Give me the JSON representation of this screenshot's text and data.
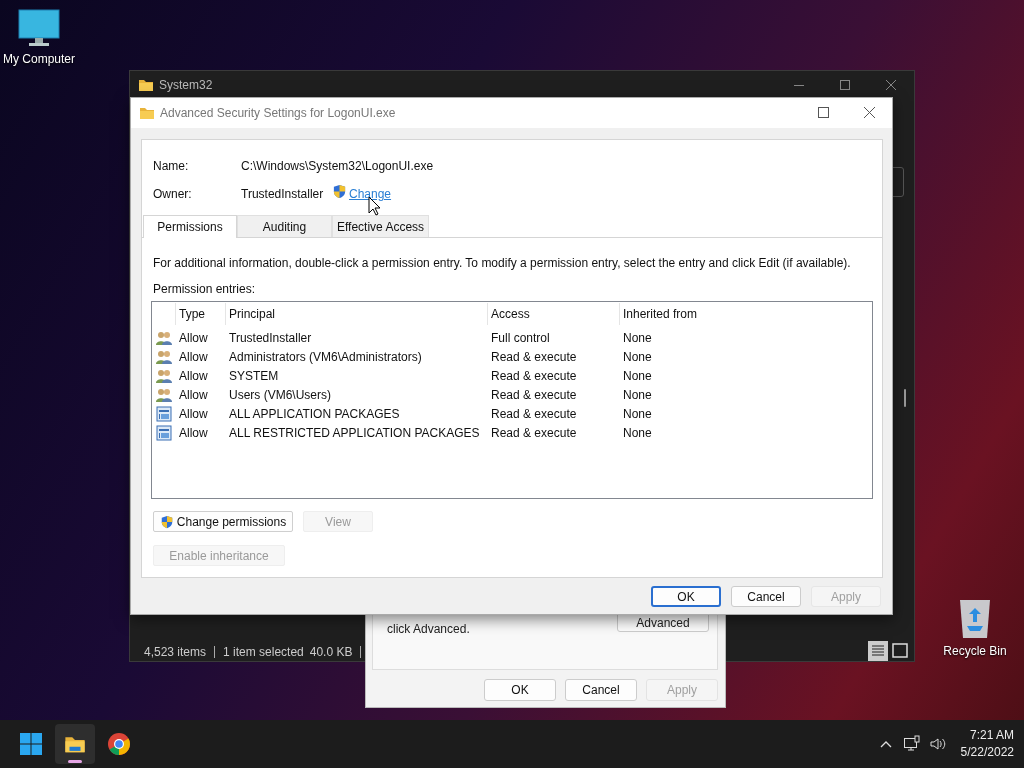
{
  "desktop_icons": [
    {
      "kind": "computer",
      "label": "My Computer"
    },
    {
      "kind": "recycle",
      "label": "Recycle Bin"
    }
  ],
  "explorer": {
    "title": "System32",
    "status_bar": [
      "4,523 items",
      "1 item selected",
      "40.0 KB"
    ]
  },
  "properties_dialog": {
    "text": "click Advanced.",
    "advanced_button": "Advanced",
    "buttons": [
      {
        "label": "OK",
        "disabled": false
      },
      {
        "label": "Cancel",
        "disabled": false
      },
      {
        "label": "Apply",
        "disabled": true
      }
    ]
  },
  "security_dialog": {
    "title": "Advanced Security Settings for LogonUI.exe",
    "name_label": "Name:",
    "name_value": "C:\\Windows\\System32\\LogonUI.exe",
    "owner_label": "Owner:",
    "owner_value": "TrustedInstaller",
    "change_link": "Change",
    "tabs": [
      {
        "label": "Permissions",
        "selected": true
      },
      {
        "label": "Auditing",
        "selected": false
      },
      {
        "label": "Effective Access",
        "selected": false
      }
    ],
    "info_text": "For additional information, double-click a permission entry. To modify a permission entry, select the entry and click Edit (if available).",
    "entries_label": "Permission entries:",
    "columns": [
      "Type",
      "Principal",
      "Access",
      "Inherited from"
    ],
    "rows": [
      {
        "kind": "user",
        "type": "Allow",
        "principal": "TrustedInstaller",
        "access": "Full control",
        "inherited_from": "None"
      },
      {
        "kind": "user",
        "type": "Allow",
        "principal": "Administrators (VM6\\Administrators)",
        "access": "Read & execute",
        "inherited_from": "None"
      },
      {
        "kind": "user",
        "type": "Allow",
        "principal": "SYSTEM",
        "access": "Read & execute",
        "inherited_from": "None"
      },
      {
        "kind": "user",
        "type": "Allow",
        "principal": "Users (VM6\\Users)",
        "access": "Read & execute",
        "inherited_from": "None"
      },
      {
        "kind": "package",
        "type": "Allow",
        "principal": "ALL APPLICATION PACKAGES",
        "access": "Read & execute",
        "inherited_from": "None"
      },
      {
        "kind": "package",
        "type": "Allow",
        "principal": "ALL RESTRICTED APPLICATION PACKAGES",
        "access": "Read & execute",
        "inherited_from": "None"
      }
    ],
    "action_buttons": [
      {
        "label": "Change permissions",
        "disabled": false,
        "shield": true
      },
      {
        "label": "View",
        "disabled": true,
        "shield": false
      }
    ],
    "inheritance_button": {
      "label": "Enable inheritance",
      "disabled": true
    },
    "footer_buttons": [
      {
        "label": "OK",
        "disabled": false,
        "default": true
      },
      {
        "label": "Cancel",
        "disabled": false,
        "default": false
      },
      {
        "label": "Apply",
        "disabled": true,
        "default": false
      }
    ]
  },
  "taskbar": {
    "apps": [
      {
        "kind": "start",
        "active": false
      },
      {
        "kind": "explorer",
        "active": true
      },
      {
        "kind": "chrome",
        "active": false
      }
    ],
    "time": "7:21 AM",
    "date": "5/22/2022"
  }
}
